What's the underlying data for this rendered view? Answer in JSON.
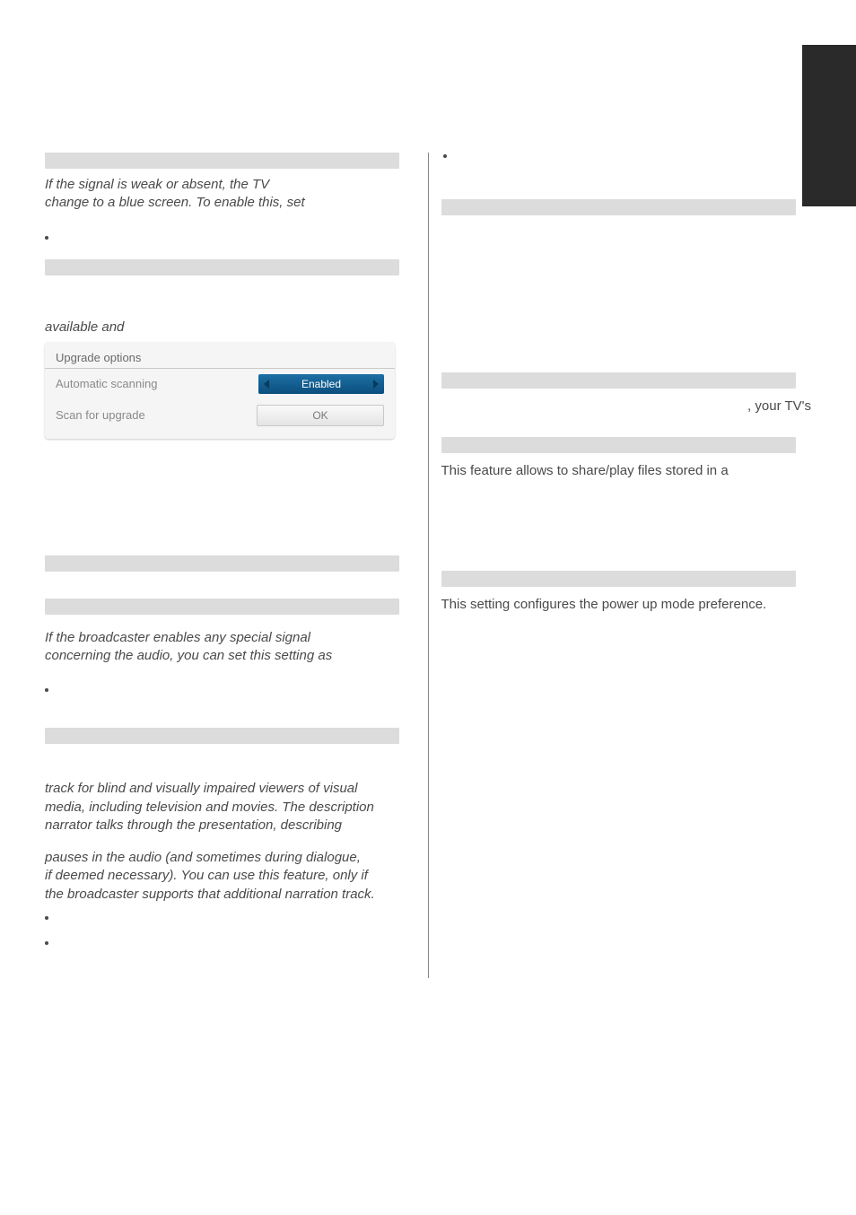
{
  "left": {
    "p1_a": "If the signal is weak or absent, the TV",
    "p1_b": "change to a blue screen. To enable this, set",
    "p2": "available and",
    "widget": {
      "title": "Upgrade options",
      "row1_label": "Automatic scanning",
      "row1_value": "Enabled",
      "row2_label": "Scan for upgrade",
      "row2_value": "OK"
    },
    "p3_a": "If the broadcaster enables any special signal",
    "p3_b": "concerning the audio, you can set this setting as",
    "p4_a": "track for blind and visually impaired viewers of visual",
    "p4_b": "media, including television and movies. The description",
    "p4_c": "narrator talks through the presentation, describing",
    "p5_a": "pauses in the audio (and sometimes during dialogue,",
    "p5_b": "if deemed necessary). You can use this feature, only if",
    "p5_c": "the broadcaster supports that additional narration track."
  },
  "right": {
    "r1": ", your TV's",
    "r2": "This feature allows to share/play files stored in a",
    "r3": "This setting configures the power up mode preference."
  }
}
